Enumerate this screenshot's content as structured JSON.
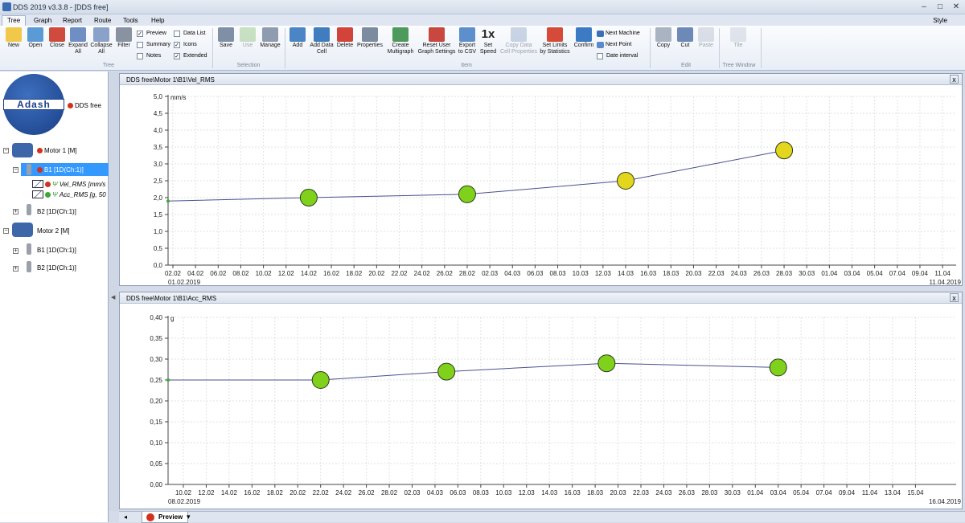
{
  "window": {
    "title": "DDS 2019 v3.3.8 - [DDS free]"
  },
  "menu": {
    "tabs": [
      "Tree",
      "Graph",
      "Report",
      "Route",
      "Tools",
      "Help"
    ],
    "style": "Style"
  },
  "ribbon": {
    "tree_buttons": [
      "New",
      "Open",
      "Close",
      "Expand All",
      "Collapse All",
      "Filter"
    ],
    "checks": [
      {
        "label": "Preview",
        "checked": true
      },
      {
        "label": "Summary",
        "checked": false
      },
      {
        "label": "Notes",
        "checked": false
      },
      {
        "label": "Data List",
        "checked": false
      },
      {
        "label": "Icons",
        "checked": true
      },
      {
        "label": "Extended",
        "checked": true
      }
    ],
    "tree_group": "Tree",
    "selection_buttons": [
      "Save",
      "Use",
      "Manage"
    ],
    "selection_group": "Selection",
    "item_buttons": [
      "Add",
      "Add Data Cell",
      "Delete",
      "Properties",
      "Create Multigraph",
      "Reset User Graph Settings",
      "Export to CSV",
      "Set Speed",
      "Copy Data Cell Properties",
      "Set Limits by Statistics",
      "Confirm"
    ],
    "speed_label": "1x",
    "nav_links": [
      "Next Machine",
      "Next Point"
    ],
    "date_interval": "Date interval",
    "item_group": "Item",
    "edit_buttons": [
      "Copy",
      "Cut",
      "Paste"
    ],
    "edit_group": "Edit",
    "tile": "Tile",
    "tree_window_group": "Tree Window"
  },
  "tree": {
    "logo": "Adash",
    "root": "DDS free",
    "nodes": [
      "Motor 1 [M]",
      "B1 [1D(Ch:1)]",
      "Vel_RMS [mm/s",
      "Acc_RMS [g, 50",
      "B2 [1D(Ch:1)]",
      "Motor 2 [M]",
      "B1 [1D(Ch:1)]",
      "B2 [1D(Ch:1)]"
    ]
  },
  "charts": {
    "vel_title": "DDS free\\Motor 1\\B1\\Vel_RMS",
    "acc_title": "DDS free\\Motor 1\\B1\\Acc_RMS",
    "close": "x"
  },
  "status": {
    "tab": "Preview"
  },
  "chart_data": [
    {
      "type": "line",
      "title": "DDS free\\Motor 1\\B1\\Vel_RMS",
      "ylabel": "mm/s",
      "ylim": [
        0,
        5
      ],
      "yticks": [
        "0,0",
        "0,5",
        "1,0",
        "1,5",
        "2,0",
        "2,5",
        "3,0",
        "3,5",
        "4,0",
        "4,5",
        "5,0"
      ],
      "xticks": [
        "02.02",
        "04.02",
        "06.02",
        "08.02",
        "10.02",
        "12.02",
        "14.02",
        "16.02",
        "18.02",
        "20.02",
        "22.02",
        "24.02",
        "26.02",
        "28.02",
        "02.03",
        "04.03",
        "06.03",
        "08.03",
        "10.03",
        "12.03",
        "14.03",
        "16.03",
        "18.03",
        "20.03",
        "22.03",
        "24.03",
        "26.03",
        "28.03",
        "30.03",
        "01.04",
        "03.04",
        "05.04",
        "07.04",
        "09.04",
        "11.04"
      ],
      "x_start": "01.02.2019",
      "x_end": "11.04.2019",
      "line": [
        {
          "x": "01.02",
          "y": 1.9
        },
        {
          "x": "14.02",
          "y": 2.0
        },
        {
          "x": "28.02",
          "y": 2.1
        },
        {
          "x": "14.03",
          "y": 2.5
        },
        {
          "x": "28.03",
          "y": 3.4
        }
      ],
      "points": [
        {
          "x": "14.02",
          "y": 2.0,
          "color": "#7fd11c"
        },
        {
          "x": "28.02",
          "y": 2.1,
          "color": "#7fd11c"
        },
        {
          "x": "14.03",
          "y": 2.5,
          "color": "#e4d61c"
        },
        {
          "x": "28.03",
          "y": 3.4,
          "color": "#e4d61c"
        }
      ],
      "grid": true
    },
    {
      "type": "line",
      "title": "DDS free\\Motor 1\\B1\\Acc_RMS",
      "ylabel": "g",
      "ylim": [
        0,
        0.4
      ],
      "yticks": [
        "0,00",
        "0,05",
        "0,10",
        "0,15",
        "0,20",
        "0,25",
        "0,30",
        "0,35",
        "0,40"
      ],
      "xticks": [
        "10.02",
        "12.02",
        "14.02",
        "16.02",
        "18.02",
        "20.02",
        "22.02",
        "24.02",
        "26.02",
        "28.02",
        "02.03",
        "04.03",
        "06.03",
        "08.03",
        "10.03",
        "12.03",
        "14.03",
        "16.03",
        "18.03",
        "20.03",
        "22.03",
        "24.03",
        "26.03",
        "28.03",
        "30.03",
        "01.04",
        "03.04",
        "05.04",
        "07.04",
        "09.04",
        "11.04",
        "13.04",
        "15.04"
      ],
      "x_start": "08.02.2019",
      "x_end": "16.04.2019",
      "line": [
        {
          "x": "08.02",
          "y": 0.25
        },
        {
          "x": "22.02",
          "y": 0.25
        },
        {
          "x": "05.03",
          "y": 0.27
        },
        {
          "x": "19.03",
          "y": 0.29
        },
        {
          "x": "03.04",
          "y": 0.28
        }
      ],
      "points": [
        {
          "x": "22.02",
          "y": 0.25,
          "color": "#7fd11c"
        },
        {
          "x": "05.03",
          "y": 0.27,
          "color": "#7fd11c"
        },
        {
          "x": "19.03",
          "y": 0.29,
          "color": "#7fd11c"
        },
        {
          "x": "03.04",
          "y": 0.28,
          "color": "#7fd11c"
        }
      ],
      "grid": true
    }
  ]
}
